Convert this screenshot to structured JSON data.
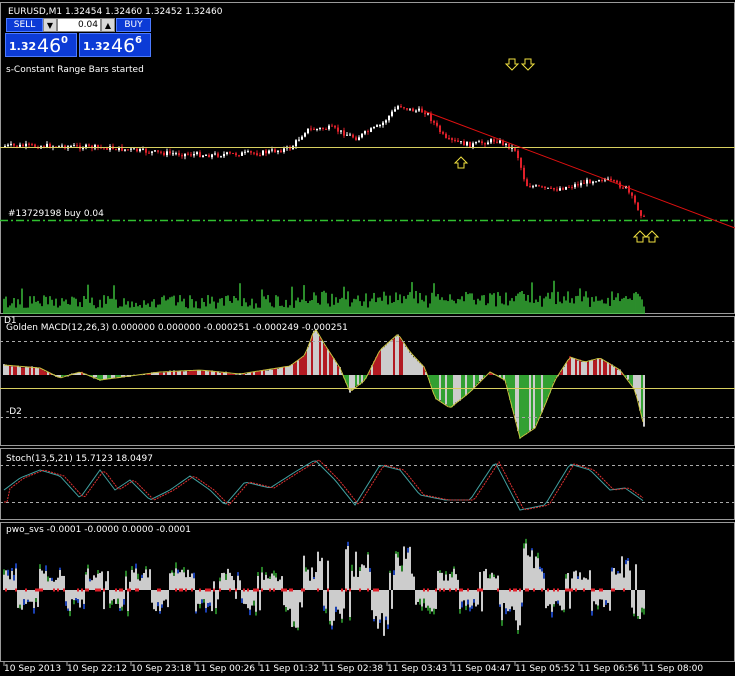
{
  "window": {
    "symbol_line": "EURUSD,M1  1.32454 1.32460 1.32452 1.32460",
    "status_message": "s-Constant Range Bars started",
    "order_label": "#13729198 buy 0.04"
  },
  "trade_panel": {
    "sell_label": "SELL",
    "buy_label": "BUY",
    "lot_value": "0.04",
    "sell_price_small": "1.32",
    "sell_price_big": "46",
    "sell_price_sup": "0",
    "buy_price_small": "1.32",
    "buy_price_big": "46",
    "buy_price_sup": "6"
  },
  "indicators": {
    "macd": {
      "corner": "D1",
      "label": "Golden MACD(12,26,3) 0.000000 0.000000 -0.000251 -0.000249 -0.000251",
      "level": "-D2"
    },
    "stoch": {
      "label": "Stoch(13,5,21) 15.7123 18.0497"
    },
    "pwo": {
      "label": "pwo_svs -0.0001 -0.0000 0.0000 -0.0001"
    }
  },
  "time_axis": [
    "10 Sep 2013",
    "10 Sep 22:12",
    "10 Sep 23:18",
    "11 Sep 00:26",
    "11 Sep 01:32",
    "11 Sep 02:38",
    "11 Sep 03:43",
    "11 Sep 04:47",
    "11 Sep 05:52",
    "11 Sep 06:56",
    "11 Sep 08:00"
  ],
  "colors": {
    "background": "#000000",
    "bull": "#ffffff",
    "bear": "#e0202a",
    "volume": "#3ec83e",
    "trendline": "#e01010",
    "hline": "#d8d060",
    "order_line": "#30c030",
    "stoch_main": "#40a0a0",
    "stoch_signal": "#e03030",
    "arrow": "#f0e040"
  }
}
